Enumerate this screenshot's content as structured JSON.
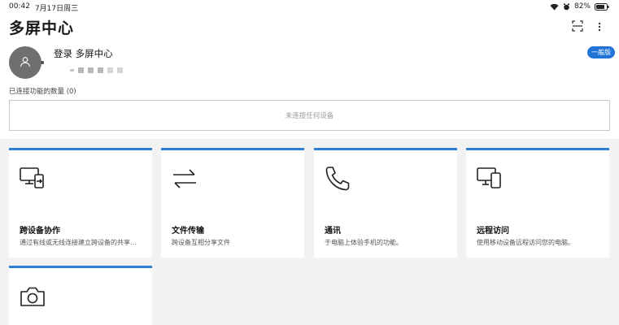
{
  "status_bar": {
    "time": "00:42",
    "date": "7月17日周三",
    "battery": "82%",
    "icons": [
      "wifi-icon",
      "alarm-icon",
      "battery-icon"
    ]
  },
  "header": {
    "title": "多屏中心",
    "actions": [
      "scan-icon",
      "more-vertical-icon"
    ]
  },
  "account": {
    "login_label": "登录 多屏中心",
    "version_badge": "一般版",
    "avatar_icon": "user-icon"
  },
  "connected": {
    "label": "已连接功能的数量 (0)",
    "empty_text": "未连接任何设备"
  },
  "features": [
    {
      "icon": "cross-device-icon",
      "title": "跨设备协作",
      "desc": "通过有线或无线连接建立跨设备的共享…"
    },
    {
      "icon": "file-transfer-icon",
      "title": "文件传输",
      "desc": "跨设备互相分享文件"
    },
    {
      "icon": "phone-icon",
      "title": "通讯",
      "desc": "于电脑上体验手机的功能。"
    },
    {
      "icon": "remote-access-icon",
      "title": "远程访问",
      "desc": "使用移动设备远程访问您的电脑。"
    },
    {
      "icon": "camera-icon",
      "title": "",
      "desc": ""
    }
  ],
  "colors": {
    "accent": "#2f7fd8",
    "badge": "#1f74d6",
    "grid_background": "#f2f2f2",
    "avatar": "#6f6f6f"
  }
}
